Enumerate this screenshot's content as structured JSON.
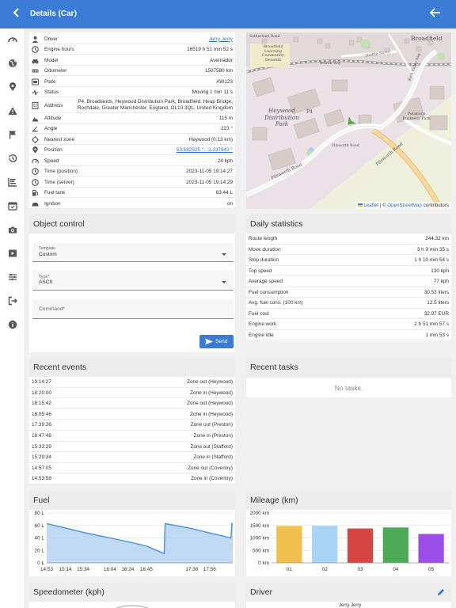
{
  "header": {
    "title": "Details (Car)",
    "back_icon": "chevron-left-icon",
    "return_icon": "arrow-left-icon"
  },
  "sidebar": [
    "speedometer-icon",
    "globe-icon",
    "map-pin-icon",
    "warning-icon",
    "flag-icon",
    "history-icon",
    "chart-icon",
    "calendar-icon",
    "camera-icon",
    "video-icon",
    "sliders-icon",
    "logout-icon",
    "info-icon"
  ],
  "info": [
    {
      "icon": "person-icon",
      "label": "Driver",
      "value": "Jerry Jerry"
    },
    {
      "icon": "clock-icon",
      "label": "Engine hours",
      "value": "16519 h 51 min 52 s"
    },
    {
      "icon": "car-icon",
      "label": "Model",
      "value": "Aventador"
    },
    {
      "icon": "odometer-icon",
      "label": "Odometer",
      "value": "1507580 km"
    },
    {
      "icon": "plate-icon",
      "label": "Plate",
      "value": "AW123"
    },
    {
      "icon": "status-icon",
      "label": "Status",
      "value": "Moving 1 min 11 s"
    },
    {
      "icon": "address-icon",
      "label": "Address",
      "value": "P4, Broadlands, Heywood Distribution Park, Broadfield, Heap Bridge, Rochdale, Greater Manchester, England, OL10 3QL, United Kingdom"
    },
    {
      "icon": "altitude-icon",
      "label": "Altitude",
      "value": "115 m"
    },
    {
      "icon": "angle-icon",
      "label": "Angle",
      "value": "223 °"
    },
    {
      "icon": "zone-icon",
      "label": "Nearest zone",
      "value": "Heywood (0.13 km)"
    },
    {
      "icon": "position-icon",
      "label": "Position",
      "value": "53.582525 °, -2.237943 °"
    },
    {
      "icon": "speed-icon",
      "label": "Speed",
      "value": "24 kph"
    },
    {
      "icon": "clock-icon",
      "label": "Time (position)",
      "value": "2023-11-05 19:14:27"
    },
    {
      "icon": "clock-icon",
      "label": "Time (server)",
      "value": "2023-11-05 19:14:29"
    },
    {
      "icon": "fuel-icon",
      "label": "Fuel tank",
      "value": "63.44 L"
    },
    {
      "icon": "ignition-icon",
      "label": "Ignition",
      "value": "on"
    }
  ],
  "map": {
    "labels": [
      "Heywood Distribution Park",
      "P4",
      "Broadfield",
      "Pilsworth Road",
      "Pilsworth Road",
      "Penmore Business Park",
      "Broadfield Learning Community Denshill",
      "Sutherland Road",
      "Roch Valley Way",
      "Shuttle Street",
      "Rowan Way",
      "Pilsworth Road"
    ],
    "attribution_leaflet": "Leaflet",
    "attribution_osm": "OpenStreetMap",
    "attribution_sep": "|  ©",
    "attribution_suffix": "contributors"
  },
  "object_control": {
    "title": "Object control",
    "template_label": "Template",
    "template_value": "Custom",
    "type_label": "Type*",
    "type_value": "ASCII",
    "command_placeholder": "Command*",
    "send_label": "Send"
  },
  "daily_statistics": {
    "title": "Daily statistics",
    "rows": [
      {
        "label": "Route length",
        "value": "244.32 km"
      },
      {
        "label": "Move duration",
        "value": "3 h 9 min 35 s"
      },
      {
        "label": "Stop duration",
        "value": "1 h 10 min 54 s"
      },
      {
        "label": "Top speed",
        "value": "130 kph"
      },
      {
        "label": "Average speed",
        "value": "77 kph"
      },
      {
        "label": "Fuel consumption",
        "value": "30.53 liters"
      },
      {
        "label": "Avg. fuel cons. (100 km)",
        "value": "12.5 liters"
      },
      {
        "label": "Fuel cost",
        "value": "32.97 EUR"
      },
      {
        "label": "Engine work",
        "value": "2 h 51 min 57 s"
      },
      {
        "label": "Engine idle",
        "value": "1 min 53 s"
      }
    ]
  },
  "recent_events": {
    "title": "Recent events",
    "rows": [
      {
        "time": "19:14:27",
        "event": "Zone out (Heywood)"
      },
      {
        "time": "18:20:00",
        "event": "Zone in (Heywood)"
      },
      {
        "time": "18:15:42",
        "event": "Zone out (Heywood)"
      },
      {
        "time": "18:05:46",
        "event": "Zone in (Heywood)"
      },
      {
        "time": "17:39:36",
        "event": "Zone out (Preston)"
      },
      {
        "time": "16:47:48",
        "event": "Zone in (Preston)"
      },
      {
        "time": "15:33:29",
        "event": "Zone out (Stafford)"
      },
      {
        "time": "15:29:34",
        "event": "Zone in (Stafford)"
      },
      {
        "time": "14:57:05",
        "event": "Zone out (Coventry)"
      },
      {
        "time": "14:53:58",
        "event": "Zone in (Coventry)"
      }
    ]
  },
  "recent_tasks": {
    "title": "Recent tasks",
    "empty": "No tasks."
  },
  "fuel": {
    "title": "Fuel"
  },
  "mileage": {
    "title": "Mileage (km)"
  },
  "speedometer": {
    "title": "Speedometer (kph)"
  },
  "driver": {
    "title": "Driver",
    "edit_icon": "pencil-icon",
    "name": "Jerry Jerry"
  },
  "chart_data": [
    {
      "type": "area",
      "x": [
        "14:53",
        "15:14",
        "15:34",
        "16:04",
        "16:24",
        "16:45",
        "17:36",
        "17:56"
      ],
      "series": [
        {
          "values": [
            [
              "14:53",
              63
            ],
            [
              "15:14",
              56
            ],
            [
              "15:34",
              49
            ],
            [
              "16:04",
              40
            ],
            [
              "16:24",
              34
            ],
            [
              "16:45",
              27
            ],
            [
              "17:05",
              15
            ],
            [
              "17:06",
              63
            ],
            [
              "17:36",
              55
            ],
            [
              "17:56",
              48
            ],
            [
              "18:20",
              40
            ],
            [
              "18:21",
              63
            ],
            [
              "18:22",
              62
            ]
          ]
        }
      ],
      "ylim": [
        0,
        80
      ],
      "yticks": [
        "0 L",
        "20 L",
        "40 L",
        "60 L",
        "80 L"
      ],
      "xticks": [
        "14:53",
        "15:14",
        "15:34",
        "16:04",
        "16:24",
        "16:45",
        "17:36",
        "17:56"
      ],
      "color": "#4a90d9",
      "fill": "#b5d3f2",
      "grid": true
    },
    {
      "type": "bar",
      "categories": [
        "01",
        "02",
        "03",
        "04",
        "05"
      ],
      "values": [
        1480,
        1490,
        1380,
        1420,
        1160
      ],
      "colors": [
        "#f0c04e",
        "#a9d4f5",
        "#d64541",
        "#4aaa55",
        "#9b4ee8"
      ],
      "ylim": [
        0,
        2000
      ],
      "yticks": [
        "0 km",
        "500 km",
        "1000 km",
        "1500 km",
        "2000 km"
      ],
      "grid": true
    }
  ]
}
